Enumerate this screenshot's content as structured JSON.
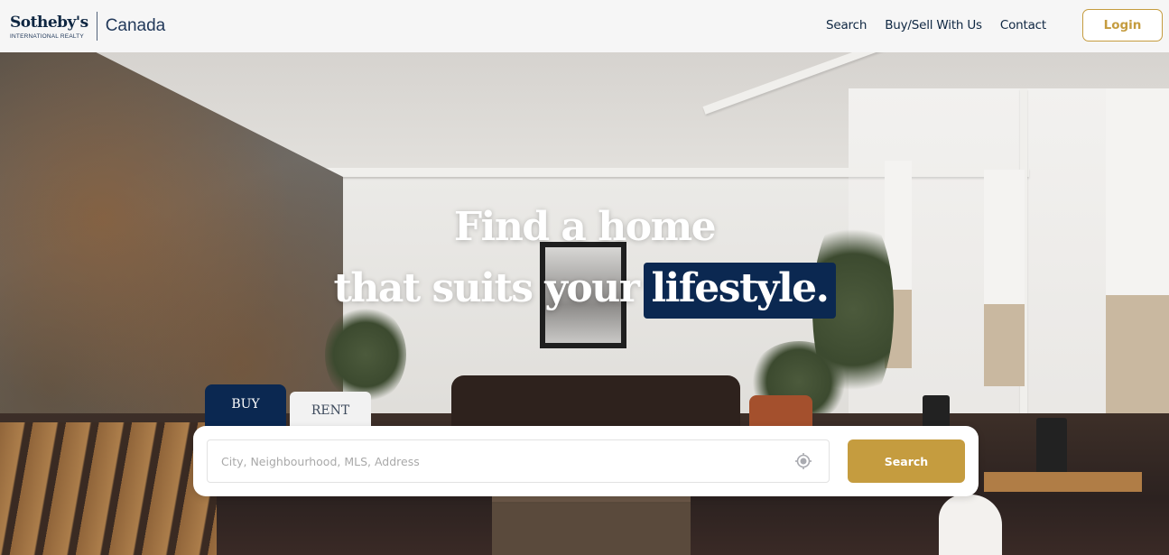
{
  "header": {
    "logo": {
      "brand": "Sotheby's",
      "subtitle": "INTERNATIONAL REALTY",
      "region": "Canada"
    },
    "nav": [
      {
        "label": "Search"
      },
      {
        "label": "Buy/Sell With Us"
      },
      {
        "label": "Contact"
      }
    ],
    "login_label": "Login"
  },
  "hero": {
    "headline_line1": "Find a home",
    "headline_line2": "that suits your",
    "headline_highlight": "lifestyle."
  },
  "search": {
    "tabs": [
      {
        "label": "BUY",
        "active": true
      },
      {
        "label": "RENT",
        "active": false
      }
    ],
    "input_value": "",
    "input_placeholder": "City, Neighbourhood, MLS, Address",
    "locate_icon": "crosshair-location-icon",
    "button_label": "Search"
  },
  "colors": {
    "brand_navy": "#0b2851",
    "accent_gold": "#c59c3f",
    "header_bg": "#f6f6f6"
  }
}
